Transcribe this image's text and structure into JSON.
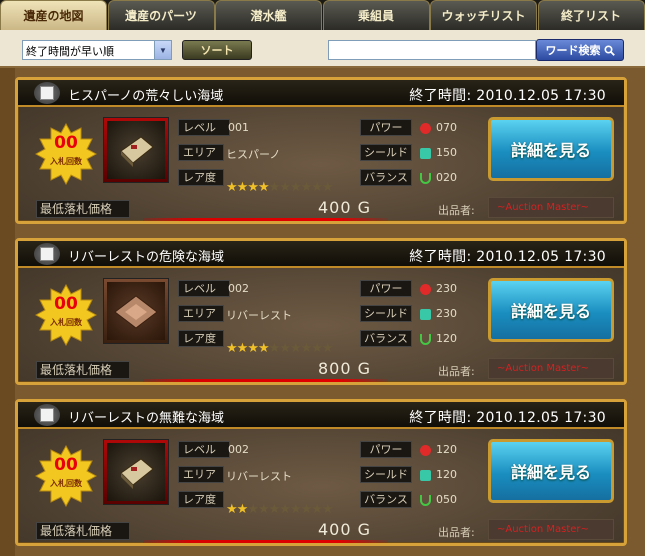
{
  "tabs": [
    "遺産の地図",
    "遺産のパーツ",
    "潜水艦",
    "乗組員",
    "ウォッチリスト",
    "終了リスト"
  ],
  "toolbar": {
    "sort_value": "終了時間が早い順",
    "sort_button": "ソート",
    "search_value": "",
    "search_button": "ワード検索"
  },
  "labels": {
    "level": "レベル",
    "area": "エリア",
    "rarity": "レア度",
    "power": "パワー",
    "shield": "シールド",
    "balance": "バランス",
    "min_price": "最低落札価格",
    "seller": "出品者:",
    "bid_count": "入札回数",
    "detail": "詳細を見る"
  },
  "items": [
    {
      "title": "ヒスパーノの荒々しい海域",
      "end_time": "終了時間: 2010.12.05 17:30",
      "bids": "00",
      "level": "001",
      "area": "ヒスパーノ",
      "rarity": 4,
      "power": "070",
      "shield": "150",
      "balance": "020",
      "price": "400 G",
      "seller": "~Auction Master~"
    },
    {
      "title": "リバーレストの危険な海域",
      "end_time": "終了時間: 2010.12.05 17:30",
      "bids": "00",
      "level": "002",
      "area": "リバーレスト",
      "rarity": 4,
      "power": "230",
      "shield": "230",
      "balance": "120",
      "price": "800 G",
      "seller": "~Auction Master~"
    },
    {
      "title": "リバーレストの無難な海域",
      "end_time": "終了時間: 2010.12.05 17:30",
      "bids": "00",
      "level": "002",
      "area": "リバーレスト",
      "rarity": 2,
      "power": "120",
      "shield": "120",
      "balance": "050",
      "price": "400 G",
      "seller": "~Auction Master~"
    }
  ],
  "rarity_max": 10,
  "colors": {
    "card_border": "#d8a23a",
    "detail_button": "#1a8ec0",
    "price_bar": "#d80000",
    "bid_number": "#e8000a"
  }
}
